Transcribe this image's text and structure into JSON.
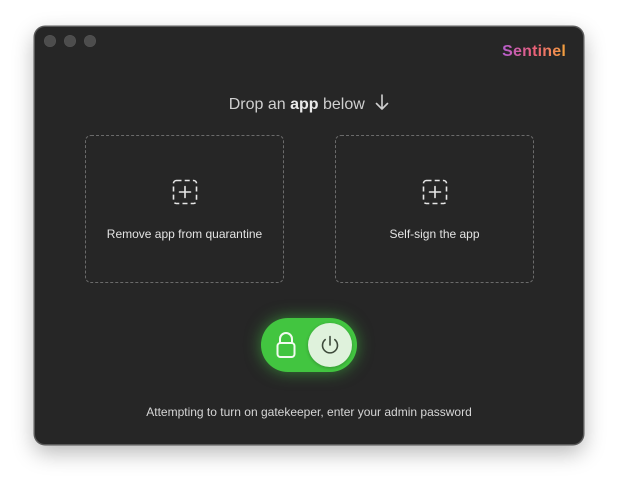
{
  "window": {
    "controls": [
      "close",
      "minimize",
      "zoom"
    ]
  },
  "brand": {
    "name": "Sentinel"
  },
  "headline": {
    "prefix": "Drop an",
    "emphasis": "app",
    "suffix": "below",
    "arrow_icon": "arrow-down-icon"
  },
  "dropzones": [
    {
      "label": "Remove app from quarantine",
      "icon": "add-square-icon"
    },
    {
      "label": "Self-sign the app",
      "icon": "add-square-icon"
    }
  ],
  "gatekeeper_toggle": {
    "state": "on",
    "icons": [
      "lock-icon",
      "power-icon"
    ],
    "color": "#42c540"
  },
  "status": {
    "message": "Attempting to turn on gatekeeper, enter your admin password"
  }
}
